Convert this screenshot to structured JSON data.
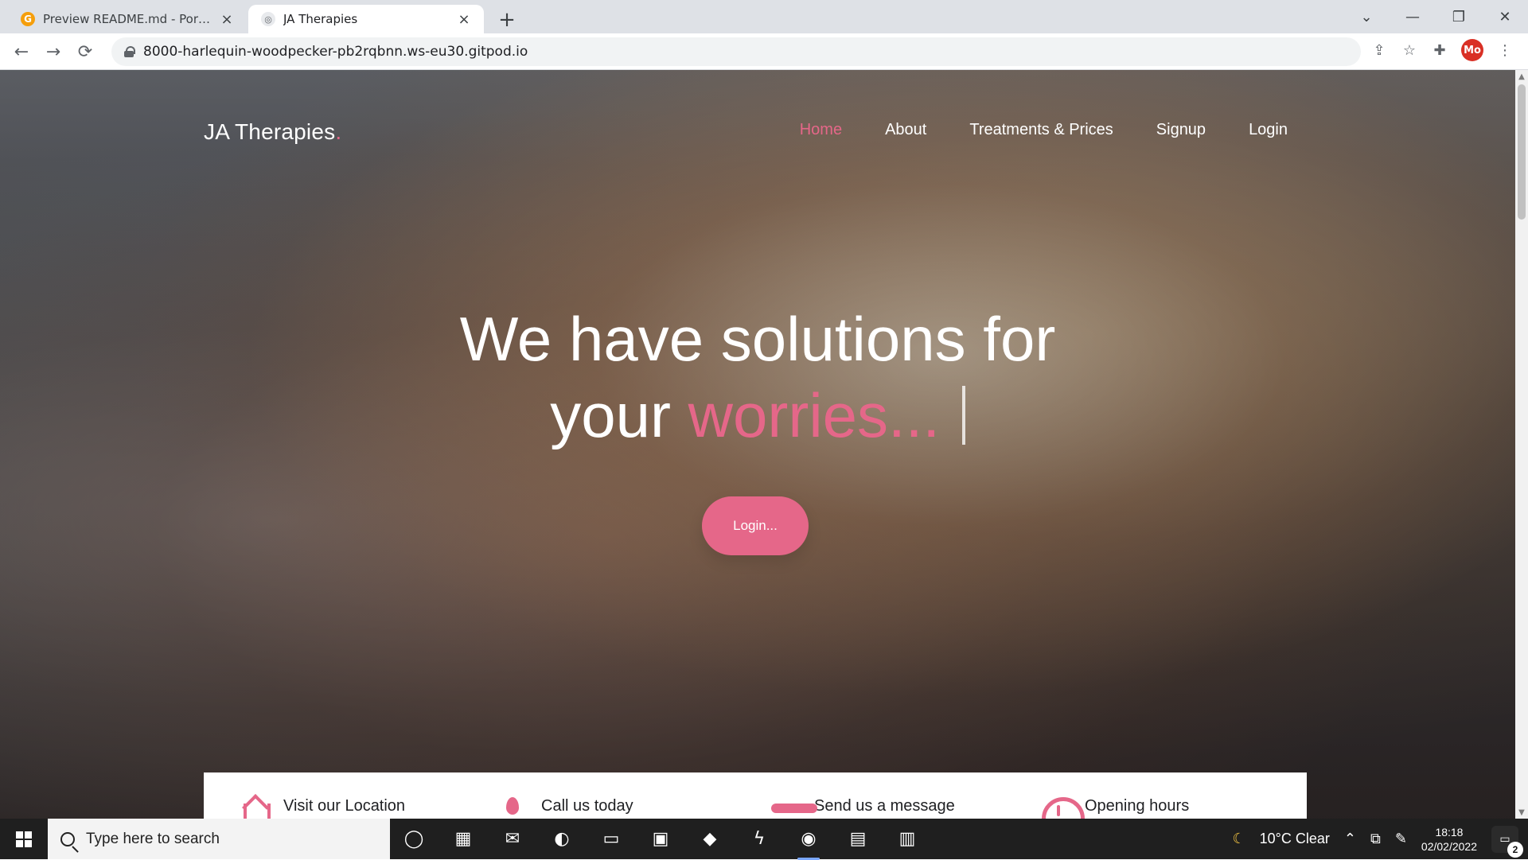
{
  "browser": {
    "tabs": [
      {
        "title": "Preview README.md - Portfolio-",
        "favicon": "gitpod-icon",
        "active": false
      },
      {
        "title": "JA Therapies",
        "favicon": "globe-icon",
        "active": true
      }
    ],
    "url": "8000-harlequin-woodpecker-pb2rqbnn.ws-eu30.gitpod.io",
    "profile_initials": "Mo"
  },
  "site": {
    "brand": "JA Therapies",
    "brand_dot": ".",
    "nav": [
      {
        "label": "Home",
        "active": true
      },
      {
        "label": "About",
        "active": false
      },
      {
        "label": "Treatments & Prices",
        "active": false
      },
      {
        "label": "Signup",
        "active": false
      },
      {
        "label": "Login",
        "active": false
      }
    ],
    "hero": {
      "line1": "We have solutions for",
      "line2_prefix": "your",
      "line2_accent": "worries...",
      "cta": "Login..."
    },
    "info": [
      {
        "label": "Visit our Location",
        "icon": "home-icon"
      },
      {
        "label": "Call us today",
        "icon": "phone-icon"
      },
      {
        "label": "Send us a message",
        "icon": "mail-icon"
      },
      {
        "label": "Opening hours",
        "icon": "clock-icon"
      }
    ]
  },
  "taskbar": {
    "search_placeholder": "Type here to search",
    "weather": "10°C Clear",
    "time": "18:18",
    "date": "02/02/2022",
    "notifications": "2"
  },
  "colors": {
    "accent": "#e56789"
  }
}
